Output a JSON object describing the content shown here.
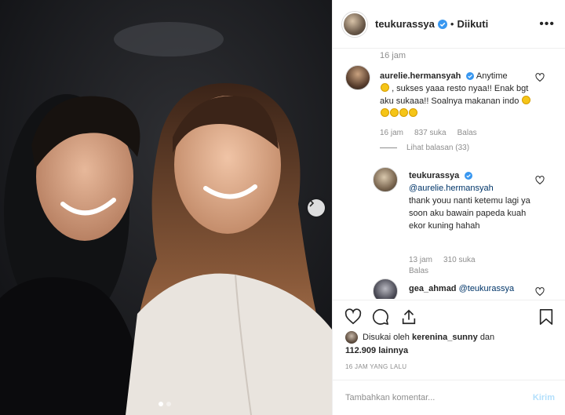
{
  "header": {
    "username": "teukurassya",
    "separator": "•",
    "follow_label": "Diikuti",
    "more_label": "•••"
  },
  "comments": {
    "top_timestamp": "16 jam",
    "items": [
      {
        "username": "aurelie.hermansyah",
        "verified": true,
        "text_1": "Anytime",
        "text_2": ", sukses yaaa resto nyaa!! Enak bgt aku sukaaa!! Soalnya makanan indo",
        "time": "16 jam",
        "likes": "837 suka",
        "reply": "Balas",
        "view_replies": "Lihat balasan (33)"
      },
      {
        "username": "teukurassya",
        "verified": true,
        "mention": "@aurelie.hermansyah",
        "text": "thank youu nanti ketemu lagi ya soon aku bawain papeda kuah ekor kuning hahah",
        "time": "13 jam",
        "likes": "310 suka",
        "reply": "Balas"
      },
      {
        "username": "gea_ahmad",
        "mention": "@teukurassya"
      }
    ]
  },
  "likes": {
    "prefix": "Disukai oleh",
    "user": "kerenina_sunny",
    "connector": "dan",
    "count": "112.909 lainnya"
  },
  "time_ago": "16 JAM YANG LALU",
  "add_comment": {
    "placeholder": "Tambahkan komentar...",
    "post_label": "Kirim"
  },
  "colors": {
    "verified": "#3897f0",
    "link": "#003569",
    "muted": "#8e8e8e",
    "post_disabled": "#b2dffc"
  },
  "icons": [
    "verified-icon",
    "more-options-icon",
    "heart-icon",
    "comment-icon",
    "share-icon",
    "bookmark-icon",
    "chevron-right-icon"
  ]
}
